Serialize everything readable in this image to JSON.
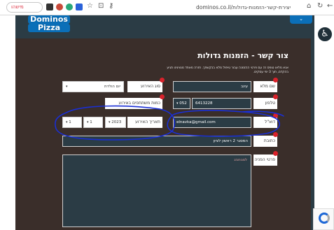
{
  "browser": {
    "update_label": "מישהו",
    "url_host": "dominos.co.il/",
    "url_path": "יצירת-קשר-הזמנות-גדולות"
  },
  "site": {
    "logo_line1": "Dominos",
    "logo_line2": "Pizza",
    "menu_label": "⌄"
  },
  "form": {
    "title": "צור קשר - הזמנות גדולות",
    "intro": "אנא מלאו טופס זה עם פרטי ההזמנה עבור טיפול מלא בבקשתך. חזרה מאחד מנציגינו תגיע בהקדם, תוך 3 ימי עסקים.",
    "name_label": "שם מלא",
    "name_value": "עינב",
    "event_type_label": "סוג האירוע",
    "event_type_value": "יום הולדת",
    "phone_label": "טלפון",
    "phone_number": "6413228",
    "phone_prefix": "052",
    "participants_label": "כמות משתתפים באירוע",
    "email_label": "דוא\"ל",
    "email_value": "elnavka@gmail.com",
    "date_label": "תאריך האירוע",
    "date_year": "2023",
    "date_month": "1",
    "date_day": "1",
    "address_label": "כתובת",
    "address_value": "המסגר 2 ראשון לציון",
    "details_label": "פרטי הפניה",
    "details_placeholder": "למנוחנזג"
  },
  "colors": {
    "brand_blue": "#0b6fb8",
    "required_red": "#d9222b",
    "ink_blue": "#1a2fd6"
  }
}
